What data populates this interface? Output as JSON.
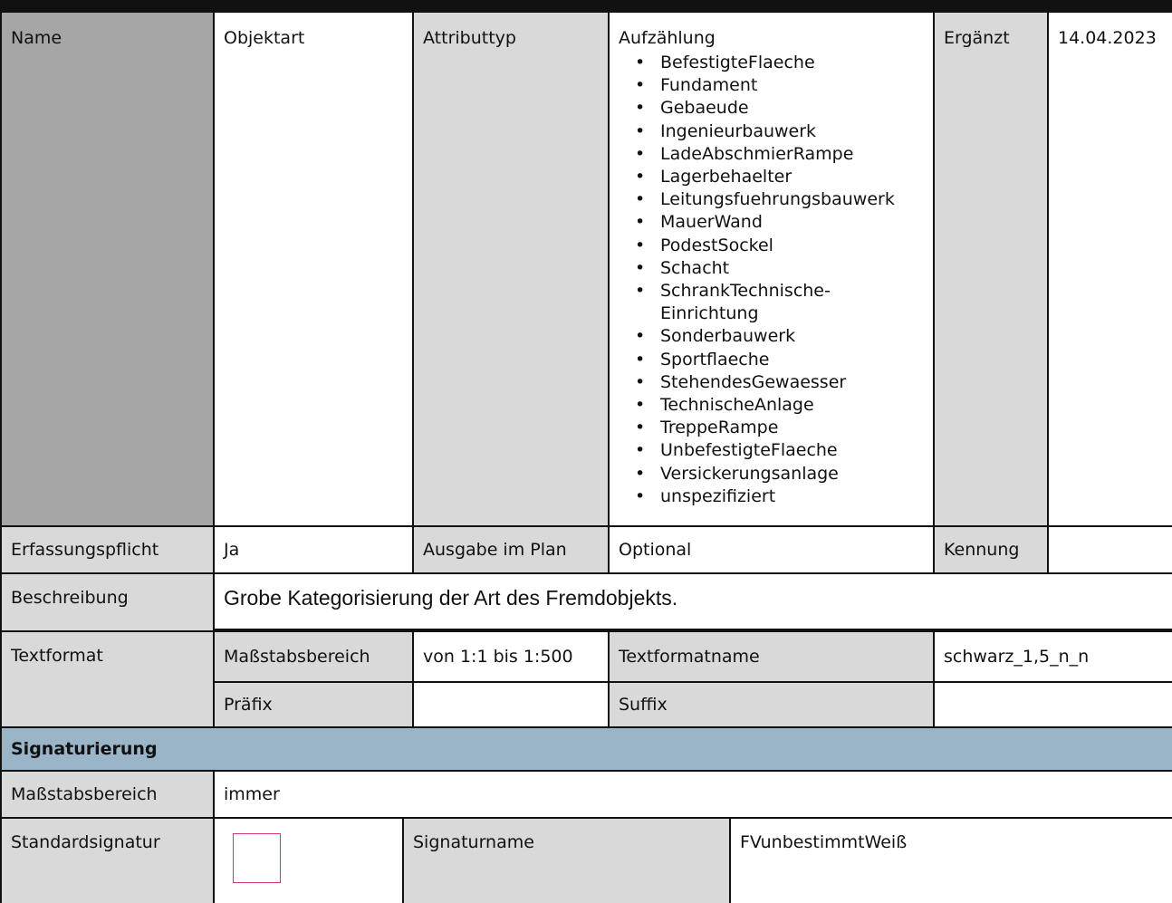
{
  "header_row": {
    "name_label": "Name",
    "name_value": "Objektart",
    "attribute_type_label": "Attributtyp",
    "attribute_type_value": "Aufzählung",
    "enum_values": [
      "BefestigteFlaeche",
      "Fundament",
      "Gebaeude",
      "Ingenieurbauwerk",
      "LadeAbschmierRampe",
      "Lagerbehaelter",
      "Leitungsfuehrungsbauwerk",
      "MauerWand",
      "PodestSockel",
      "Schacht",
      "SchrankTechnische-Einrichtung",
      "Sonderbauwerk",
      "Sportflaeche",
      "StehendesGewaesser",
      "TechnischeAnlage",
      "TreppeRampe",
      "UnbefestigteFlaeche",
      "Versickerungsanlage",
      "unspezifiziert"
    ],
    "added_label": "Ergänzt",
    "added_value": "14.04.2023"
  },
  "capture_row": {
    "required_label": "Erfassungspflicht",
    "required_value": "Ja",
    "plan_output_label": "Ausgabe im Plan",
    "plan_output_value": "Optional",
    "id_label": "Kennung",
    "id_value": ""
  },
  "description": {
    "label": "Beschreibung",
    "value": "Grobe Kategorisierung der Art des Fremdobjekts."
  },
  "text_format": {
    "label": "Textformat",
    "scale_label": "Maßstabsbereich",
    "scale_value": "von 1:1 bis 1:500",
    "name_label": "Textformatname",
    "name_value": "schwarz_1,5_n_n",
    "prefix_label": "Präfix",
    "prefix_value": "",
    "suffix_label": "Suffix",
    "suffix_value": ""
  },
  "signature": {
    "section_title": "Signaturierung",
    "scale_label": "Maßstabsbereich",
    "scale_value": "immer",
    "standard_label": "Standardsignatur",
    "name_label": "Signaturname",
    "name_value": "FVunbestimmtWeiß",
    "swatch_border_color": "#d63384"
  }
}
